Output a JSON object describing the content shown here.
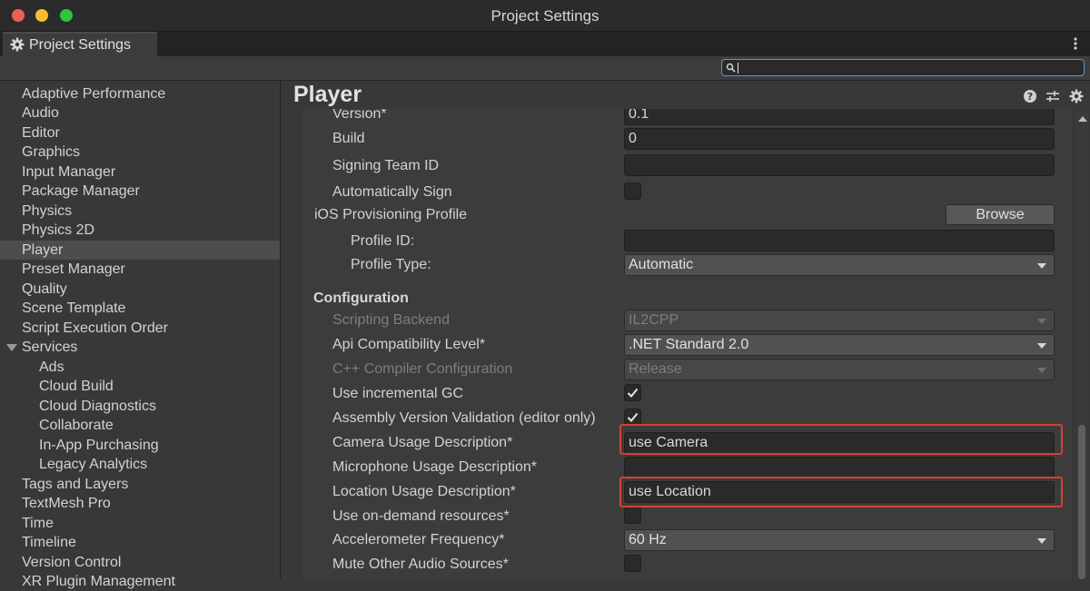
{
  "window": {
    "title": "Project Settings"
  },
  "tab": {
    "label": "Project Settings",
    "icon": "gear-icon"
  },
  "search": {
    "value": "",
    "placeholder": ""
  },
  "sidebar": {
    "items": [
      {
        "label": "Adaptive Performance"
      },
      {
        "label": "Audio"
      },
      {
        "label": "Editor"
      },
      {
        "label": "Graphics"
      },
      {
        "label": "Input Manager"
      },
      {
        "label": "Package Manager"
      },
      {
        "label": "Physics"
      },
      {
        "label": "Physics 2D"
      },
      {
        "label": "Player",
        "selected": true
      },
      {
        "label": "Preset Manager"
      },
      {
        "label": "Quality"
      },
      {
        "label": "Scene Template"
      },
      {
        "label": "Script Execution Order"
      },
      {
        "label": "Services",
        "expanded": true
      },
      {
        "label": "Ads",
        "child": true
      },
      {
        "label": "Cloud Build",
        "child": true
      },
      {
        "label": "Cloud Diagnostics",
        "child": true
      },
      {
        "label": "Collaborate",
        "child": true
      },
      {
        "label": "In-App Purchasing",
        "child": true
      },
      {
        "label": "Legacy Analytics",
        "child": true
      },
      {
        "label": "Tags and Layers"
      },
      {
        "label": "TextMesh Pro"
      },
      {
        "label": "Time"
      },
      {
        "label": "Timeline"
      },
      {
        "label": "Version Control"
      },
      {
        "label": "XR Plugin Management"
      }
    ]
  },
  "main": {
    "title": "Player",
    "header_icons": [
      "help-icon",
      "presets-icon",
      "settings-gear-icon"
    ],
    "rows": {
      "version": {
        "label": "Version*",
        "value": "0.1"
      },
      "build": {
        "label": "Build",
        "value": "0"
      },
      "signing_team": {
        "label": "Signing Team ID",
        "value": ""
      },
      "auto_sign": {
        "label": "Automatically Sign",
        "checked": false
      },
      "provisioning": {
        "label": "iOS Provisioning Profile",
        "button": "Browse"
      },
      "profile_id": {
        "label": "Profile ID:",
        "value": ""
      },
      "profile_type": {
        "label": "Profile Type:",
        "value": "Automatic"
      },
      "configuration": {
        "label": "Configuration"
      },
      "scripting_backend": {
        "label": "Scripting Backend",
        "value": "IL2CPP",
        "disabled": true
      },
      "api_level": {
        "label": "Api Compatibility Level*",
        "value": ".NET Standard 2.0"
      },
      "cpp_config": {
        "label": "C++ Compiler Configuration",
        "value": "Release",
        "disabled": true
      },
      "incremental_gc": {
        "label": "Use incremental GC",
        "checked": true
      },
      "assembly_validation": {
        "label": "Assembly Version Validation (editor only)",
        "checked": true
      },
      "camera_usage": {
        "label": "Camera Usage Description*",
        "value": "use Camera"
      },
      "microphone_usage": {
        "label": "Microphone Usage Description*",
        "value": ""
      },
      "location_usage": {
        "label": "Location Usage Description*",
        "value": "use Location"
      },
      "on_demand": {
        "label": "Use on-demand resources*",
        "checked": false
      },
      "accelerometer": {
        "label": "Accelerometer Frequency*",
        "value": "60 Hz"
      },
      "mute_audio": {
        "label": "Mute Other Audio Sources*",
        "checked": false
      }
    }
  },
  "colors": {
    "highlight": "#d7402f",
    "accent": "#5a95e0",
    "background": "#383838"
  }
}
